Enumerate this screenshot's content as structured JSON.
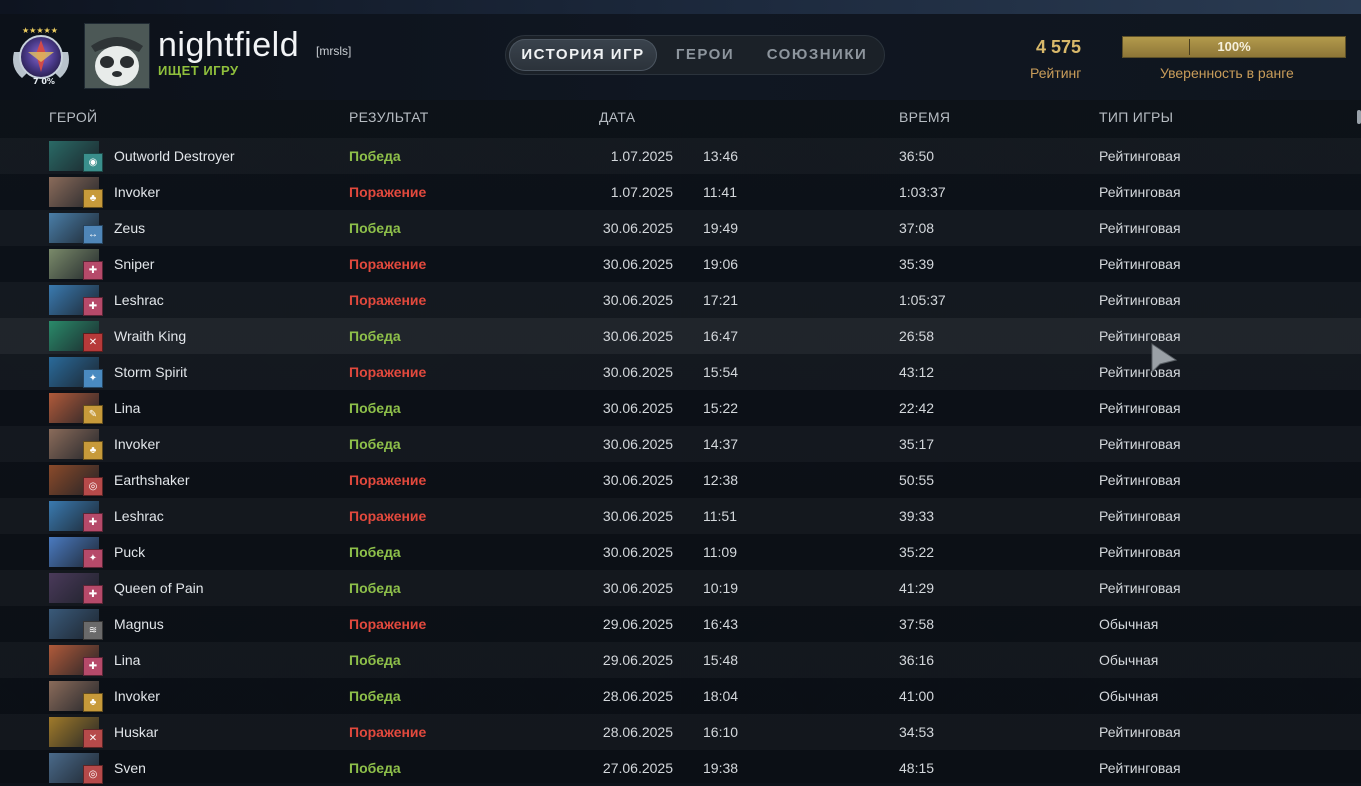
{
  "profile": {
    "username": "nightfield",
    "clan_tag": "[mrsls]",
    "status": "ИЩЕТ ИГРУ",
    "medal_rank": "7 0%"
  },
  "tabs": [
    {
      "label": "ИСТОРИЯ ИГР",
      "active": true
    },
    {
      "label": "ГЕРОИ",
      "active": false
    },
    {
      "label": "СОЮЗНИКИ",
      "active": false
    }
  ],
  "rating": {
    "value": "4 575",
    "label": "Рейтинг",
    "confidence_text": "100%",
    "confidence_fraction": 1.0,
    "confidence_label": "Уверенность в ранге"
  },
  "columns": {
    "hero": "ГЕРОЙ",
    "result": "РЕЗУЛЬТАТ",
    "date": "ДАТА",
    "duration": "ВРЕМЯ",
    "game_type": "ТИП ИГРЫ"
  },
  "colors": {
    "win": "#8ec04a",
    "loss": "#e2493d",
    "accent_gold": "#d8b86a"
  },
  "matches": [
    {
      "hero": "Outworld Destroyer",
      "result": "Победа",
      "win": true,
      "date": "1.07.2025",
      "time": "13:46",
      "duration": "36:50",
      "type": "Рейтинговая",
      "hero_color": "#2a6a66",
      "role_color": "#3a8f8c",
      "role_icon": "◉"
    },
    {
      "hero": "Invoker",
      "result": "Поражение",
      "win": false,
      "date": "1.07.2025",
      "time": "11:41",
      "duration": "1:03:37",
      "type": "Рейтинговая",
      "hero_color": "#8a6b5a",
      "role_color": "#c79a3a",
      "role_icon": "♣"
    },
    {
      "hero": "Zeus",
      "result": "Победа",
      "win": true,
      "date": "30.06.2025",
      "time": "19:49",
      "duration": "37:08",
      "type": "Рейтинговая",
      "hero_color": "#4a7ea8",
      "role_color": "#4f86b8",
      "role_icon": "↔"
    },
    {
      "hero": "Sniper",
      "result": "Поражение",
      "win": false,
      "date": "30.06.2025",
      "time": "19:06",
      "duration": "35:39",
      "type": "Рейтинговая",
      "hero_color": "#7a8a6a",
      "role_color": "#b64a6a",
      "role_icon": "✚"
    },
    {
      "hero": "Leshrac",
      "result": "Поражение",
      "win": false,
      "date": "30.06.2025",
      "time": "17:21",
      "duration": "1:05:37",
      "type": "Рейтинговая",
      "hero_color": "#3a7ab0",
      "role_color": "#b64a6a",
      "role_icon": "✚"
    },
    {
      "hero": "Wraith King",
      "result": "Победа",
      "win": true,
      "date": "30.06.2025",
      "time": "16:47",
      "duration": "26:58",
      "type": "Рейтинговая",
      "hero_color": "#2a8a6a",
      "role_color": "#b63a3a",
      "role_icon": "✕"
    },
    {
      "hero": "Storm Spirit",
      "result": "Поражение",
      "win": false,
      "date": "30.06.2025",
      "time": "15:54",
      "duration": "43:12",
      "type": "Рейтинговая",
      "hero_color": "#2a6a9a",
      "role_color": "#4a8ac0",
      "role_icon": "✦"
    },
    {
      "hero": "Lina",
      "result": "Победа",
      "win": true,
      "date": "30.06.2025",
      "time": "15:22",
      "duration": "22:42",
      "type": "Рейтинговая",
      "hero_color": "#b05a3a",
      "role_color": "#c79a3a",
      "role_icon": "✎"
    },
    {
      "hero": "Invoker",
      "result": "Победа",
      "win": true,
      "date": "30.06.2025",
      "time": "14:37",
      "duration": "35:17",
      "type": "Рейтинговая",
      "hero_color": "#8a6b5a",
      "role_color": "#c79a3a",
      "role_icon": "♣"
    },
    {
      "hero": "Earthshaker",
      "result": "Поражение",
      "win": false,
      "date": "30.06.2025",
      "time": "12:38",
      "duration": "50:55",
      "type": "Рейтинговая",
      "hero_color": "#8a4a2a",
      "role_color": "#b64a4a",
      "role_icon": "◎"
    },
    {
      "hero": "Leshrac",
      "result": "Поражение",
      "win": false,
      "date": "30.06.2025",
      "time": "11:51",
      "duration": "39:33",
      "type": "Рейтинговая",
      "hero_color": "#3a7ab0",
      "role_color": "#b64a6a",
      "role_icon": "✚"
    },
    {
      "hero": "Puck",
      "result": "Победа",
      "win": true,
      "date": "30.06.2025",
      "time": "11:09",
      "duration": "35:22",
      "type": "Рейтинговая",
      "hero_color": "#4a7ac0",
      "role_color": "#b64a6a",
      "role_icon": "✦"
    },
    {
      "hero": "Queen of Pain",
      "result": "Победа",
      "win": true,
      "date": "30.06.2025",
      "time": "10:19",
      "duration": "41:29",
      "type": "Рейтинговая",
      "hero_color": "#4a3a5a",
      "role_color": "#b64a6a",
      "role_icon": "✚"
    },
    {
      "hero": "Magnus",
      "result": "Поражение",
      "win": false,
      "date": "29.06.2025",
      "time": "16:43",
      "duration": "37:58",
      "type": "Обычная",
      "hero_color": "#3a5a7a",
      "role_color": "#6a6a6a",
      "role_icon": "≋"
    },
    {
      "hero": "Lina",
      "result": "Победа",
      "win": true,
      "date": "29.06.2025",
      "time": "15:48",
      "duration": "36:16",
      "type": "Обычная",
      "hero_color": "#b05a3a",
      "role_color": "#b64a6a",
      "role_icon": "✚"
    },
    {
      "hero": "Invoker",
      "result": "Победа",
      "win": true,
      "date": "28.06.2025",
      "time": "18:04",
      "duration": "41:00",
      "type": "Обычная",
      "hero_color": "#8a6b5a",
      "role_color": "#c79a3a",
      "role_icon": "♣"
    },
    {
      "hero": "Huskar",
      "result": "Поражение",
      "win": false,
      "date": "28.06.2025",
      "time": "16:10",
      "duration": "34:53",
      "type": "Рейтинговая",
      "hero_color": "#a07a2a",
      "role_color": "#b64a4a",
      "role_icon": "✕"
    },
    {
      "hero": "Sven",
      "result": "Победа",
      "win": true,
      "date": "27.06.2025",
      "time": "19:38",
      "duration": "48:15",
      "type": "Рейтинговая",
      "hero_color": "#4a6a8a",
      "role_color": "#b64a4a",
      "role_icon": "◎"
    }
  ]
}
